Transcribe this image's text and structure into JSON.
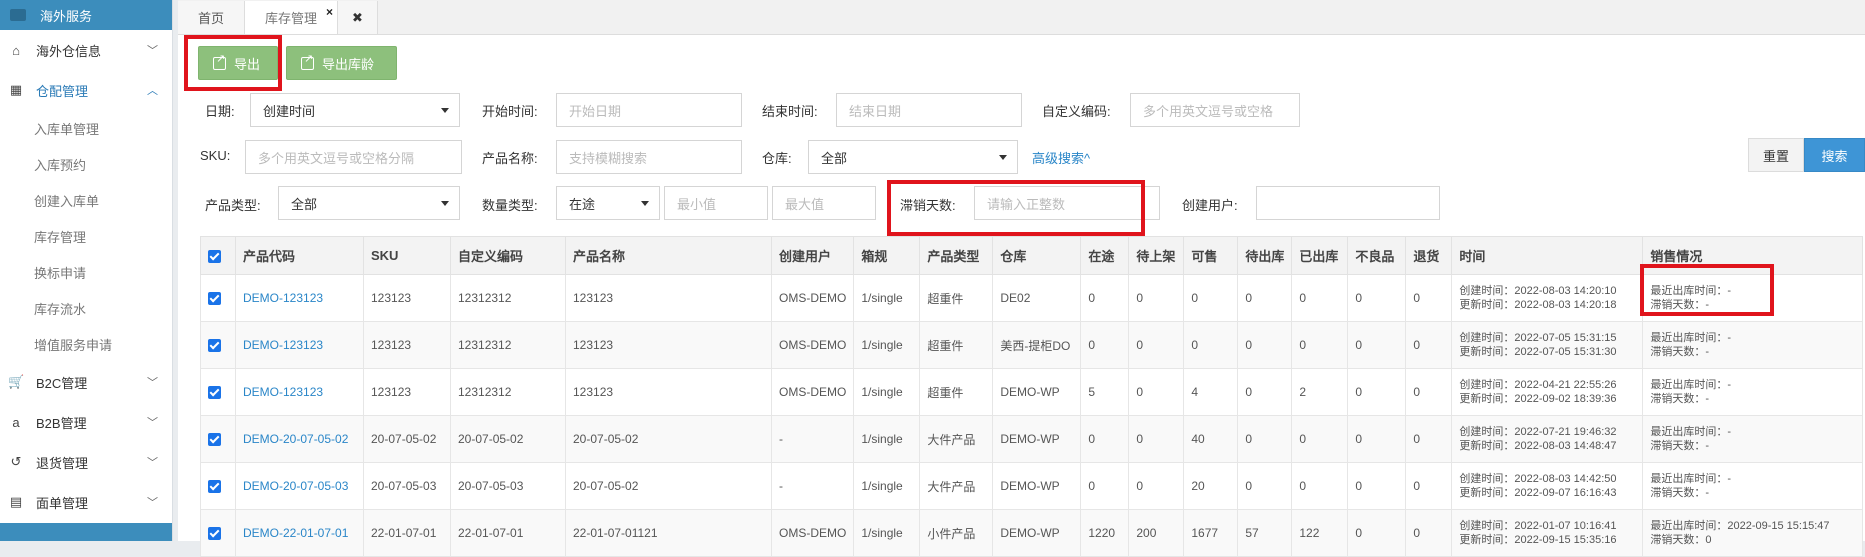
{
  "sidebar": {
    "top_label": "海外服务",
    "items": [
      {
        "label": "海外仓信息",
        "icon": "home-icon"
      },
      {
        "label": "仓配管理",
        "icon": "grid-icon"
      },
      {
        "label": "B2C管理",
        "icon": "cart-icon"
      },
      {
        "label": "B2B管理",
        "icon": "amazon-icon"
      },
      {
        "label": "退货管理",
        "icon": "return-icon"
      },
      {
        "label": "面单管理",
        "icon": "document-icon"
      }
    ],
    "sub_items": [
      "入库单管理",
      "入库预约",
      "创建入库单",
      "库存管理",
      "换标申请",
      "库存流水",
      "增值服务申请"
    ]
  },
  "tabs": {
    "home": "首页",
    "inventory": "库存管理",
    "close_icon": "×",
    "close_all": "✖"
  },
  "toolbar": {
    "export": "导出",
    "export_age": "导出库龄"
  },
  "filters": {
    "date_label": "日期:",
    "date_value": "创建时间",
    "start_label": "开始时间:",
    "start_placeholder": "开始日期",
    "end_label": "结束时间:",
    "end_placeholder": "结束日期",
    "custom_code_label": "自定义编码:",
    "custom_code_placeholder": "多个用英文逗号或空格",
    "sku_label": "SKU:",
    "sku_placeholder": "多个用英文逗号或空格分隔",
    "product_name_label": "产品名称:",
    "product_name_placeholder": "支持模糊搜索",
    "warehouse_label": "仓库:",
    "warehouse_value": "全部",
    "advanced_search": "高级搜索^",
    "reset": "重置",
    "search": "搜索",
    "product_type_label": "产品类型:",
    "product_type_value": "全部",
    "qty_type_label": "数量类型:",
    "qty_type_value": "在途",
    "min_placeholder": "最小值",
    "max_placeholder": "最大值",
    "stagnant_label": "滞销天数:",
    "stagnant_placeholder": "请输入正整数",
    "creator_label": "创建用户:"
  },
  "table": {
    "headers": [
      "产品代码",
      "SKU",
      "自定义编码",
      "产品名称",
      "创建用户",
      "箱规",
      "产品类型",
      "仓库",
      "在途",
      "待上架",
      "可售",
      "待出库",
      "已出库",
      "不良品",
      "退货",
      "时间",
      "销售情况"
    ],
    "rows": [
      {
        "code": "DEMO-123123",
        "sku": "123123",
        "custom": "12312312",
        "name": "123123",
        "creator": "OMS-DEMO",
        "box": "1/single",
        "type": "超重件",
        "warehouse": "DE02",
        "transit": "0",
        "pending": "0",
        "sellable": "0",
        "to_ship": "0",
        "shipped": "0",
        "defective": "0",
        "returned": "0",
        "created": "创建时间：2022-08-03 14:20:10",
        "updated": "更新时间：2022-08-03 14:20:18",
        "last_out": "最近出库时间：-",
        "stagnant": "滞销天数：-"
      },
      {
        "code": "DEMO-123123",
        "sku": "123123",
        "custom": "12312312",
        "name": "123123",
        "creator": "OMS-DEMO",
        "box": "1/single",
        "type": "超重件",
        "warehouse": "美西-提柜DO",
        "transit": "0",
        "pending": "0",
        "sellable": "0",
        "to_ship": "0",
        "shipped": "0",
        "defective": "0",
        "returned": "0",
        "created": "创建时间：2022-07-05 15:31:15",
        "updated": "更新时间：2022-07-05 15:31:30",
        "last_out": "最近出库时间：-",
        "stagnant": "滞销天数：-"
      },
      {
        "code": "DEMO-123123",
        "sku": "123123",
        "custom": "12312312",
        "name": "123123",
        "creator": "OMS-DEMO",
        "box": "1/single",
        "type": "超重件",
        "warehouse": "DEMO-WP",
        "transit": "5",
        "pending": "0",
        "sellable": "4",
        "to_ship": "0",
        "shipped": "2",
        "defective": "0",
        "returned": "0",
        "created": "创建时间：2022-04-21 22:55:26",
        "updated": "更新时间：2022-09-02 18:39:36",
        "last_out": "最近出库时间：-",
        "stagnant": "滞销天数：-"
      },
      {
        "code": "DEMO-20-07-05-02",
        "sku": "20-07-05-02",
        "custom": "20-07-05-02",
        "name": "20-07-05-02",
        "creator": "-",
        "box": "1/single",
        "type": "大件产品",
        "warehouse": "DEMO-WP",
        "transit": "0",
        "pending": "0",
        "sellable": "40",
        "to_ship": "0",
        "shipped": "0",
        "defective": "0",
        "returned": "0",
        "created": "创建时间：2022-07-21 19:46:32",
        "updated": "更新时间：2022-08-03 14:48:47",
        "last_out": "最近出库时间：-",
        "stagnant": "滞销天数：-"
      },
      {
        "code": "DEMO-20-07-05-03",
        "sku": "20-07-05-03",
        "custom": "20-07-05-03",
        "name": "20-07-05-02",
        "creator": "-",
        "box": "1/single",
        "type": "大件产品",
        "warehouse": "DEMO-WP",
        "transit": "0",
        "pending": "0",
        "sellable": "20",
        "to_ship": "0",
        "shipped": "0",
        "defective": "0",
        "returned": "0",
        "created": "创建时间：2022-08-03 14:42:50",
        "updated": "更新时间：2022-09-07 16:16:43",
        "last_out": "最近出库时间：-",
        "stagnant": "滞销天数：-"
      },
      {
        "code": "DEMO-22-01-07-01",
        "sku": "22-01-07-01",
        "custom": "22-01-07-01",
        "name": "22-01-07-01121",
        "creator": "OMS-DEMO",
        "box": "1/single",
        "type": "小件产品",
        "warehouse": "DEMO-WP",
        "transit": "1220",
        "pending": "200",
        "sellable": "1677",
        "to_ship": "57",
        "shipped": "122",
        "defective": "0",
        "returned": "0",
        "created": "创建时间：2022-01-07 10:16:41",
        "updated": "更新时间：2022-09-15 15:35:16",
        "last_out": "最近出库时间：2022-09-15 15:15:47",
        "stagnant": "滞销天数：0"
      }
    ]
  }
}
